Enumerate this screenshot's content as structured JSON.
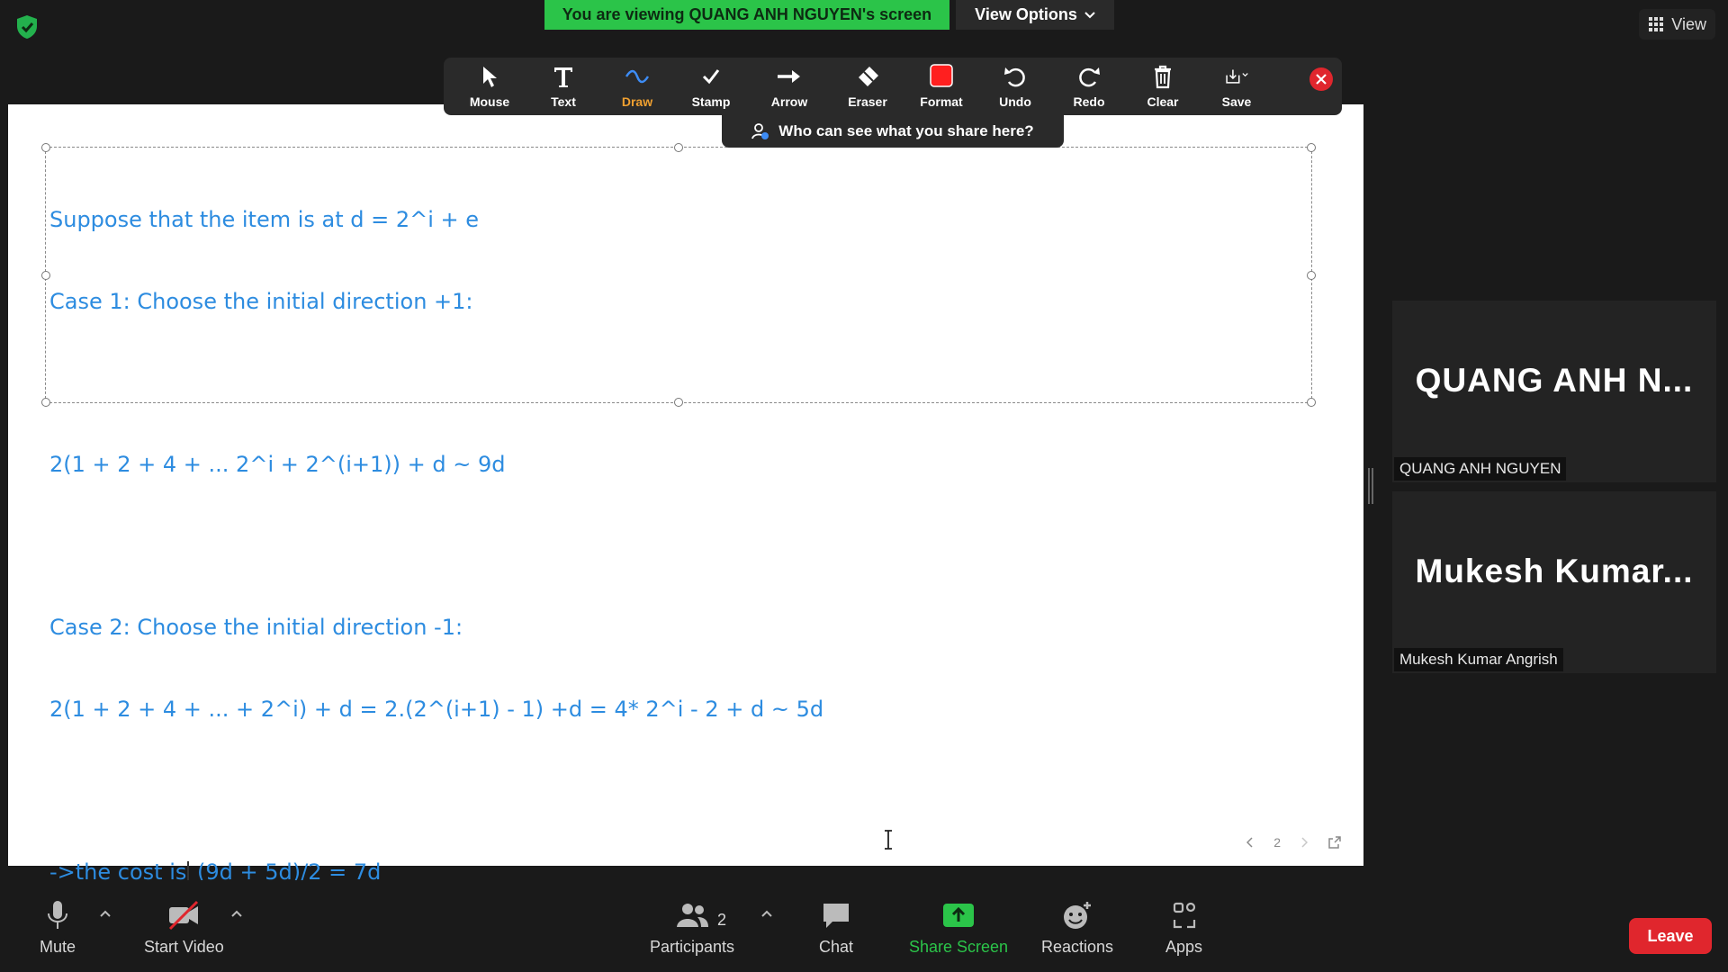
{
  "top_bar": {
    "viewing_banner": "You are viewing QUANG ANH NGUYEN's screen",
    "view_options_label": "View Options",
    "view_label": "View"
  },
  "toolbar": {
    "tools": [
      {
        "id": "mouse",
        "label": "Mouse",
        "icon": "mouse-pointer-icon"
      },
      {
        "id": "text",
        "label": "Text",
        "icon": "text-icon"
      },
      {
        "id": "draw",
        "label": "Draw",
        "icon": "draw-icon",
        "active": true
      },
      {
        "id": "stamp",
        "label": "Stamp",
        "icon": "checkmark-icon"
      },
      {
        "id": "arrow",
        "label": "Arrow",
        "icon": "arrow-icon"
      },
      {
        "id": "eraser",
        "label": "Eraser",
        "icon": "eraser-icon"
      },
      {
        "id": "format",
        "label": "Format",
        "icon": "color-square-icon",
        "color": "#ff1f1f"
      },
      {
        "id": "undo",
        "label": "Undo",
        "icon": "undo-icon"
      },
      {
        "id": "redo",
        "label": "Redo",
        "icon": "redo-icon"
      },
      {
        "id": "clear",
        "label": "Clear",
        "icon": "trash-icon"
      },
      {
        "id": "save",
        "label": "Save",
        "icon": "download-icon"
      }
    ],
    "who_can_see": "Who can see what you share here?"
  },
  "board": {
    "lines": [
      "Suppose that the item is at d = 2^i + e",
      "Case 1: Choose the initial direction +1:",
      "",
      "2(1 + 2 + 4 + ... 2^i + 2^(i+1)) + d ~ 9d",
      "",
      "Case 2: Choose the initial direction -1:",
      "2(1 + 2 + 4 + ... + 2^i) + d = 2.(2^(i+1) - 1) +d = 4* 2^i - 2 + d ~ 5d",
      ""
    ],
    "last_line_before_caret": "->the cost is",
    "last_line_after_caret": " (9d + 5d)/2 = 7d",
    "text_color": "#2d8ce0",
    "page_number": "2"
  },
  "participants": [
    {
      "display": "QUANG ANH N...",
      "full_name": "QUANG ANH NGUYEN"
    },
    {
      "display": "Mukesh  Kumar...",
      "full_name": "Mukesh Kumar Angrish"
    }
  ],
  "bottom_bar": {
    "mute_label": "Mute",
    "start_video_label": "Start Video",
    "participants_label": "Participants",
    "participants_count": "2",
    "chat_label": "Chat",
    "share_screen_label": "Share Screen",
    "reactions_label": "Reactions",
    "apps_label": "Apps",
    "leave_label": "Leave"
  },
  "colors": {
    "accent_green": "#2bc449",
    "leave_red": "#e0262d",
    "active_tool": "#f0a030"
  }
}
